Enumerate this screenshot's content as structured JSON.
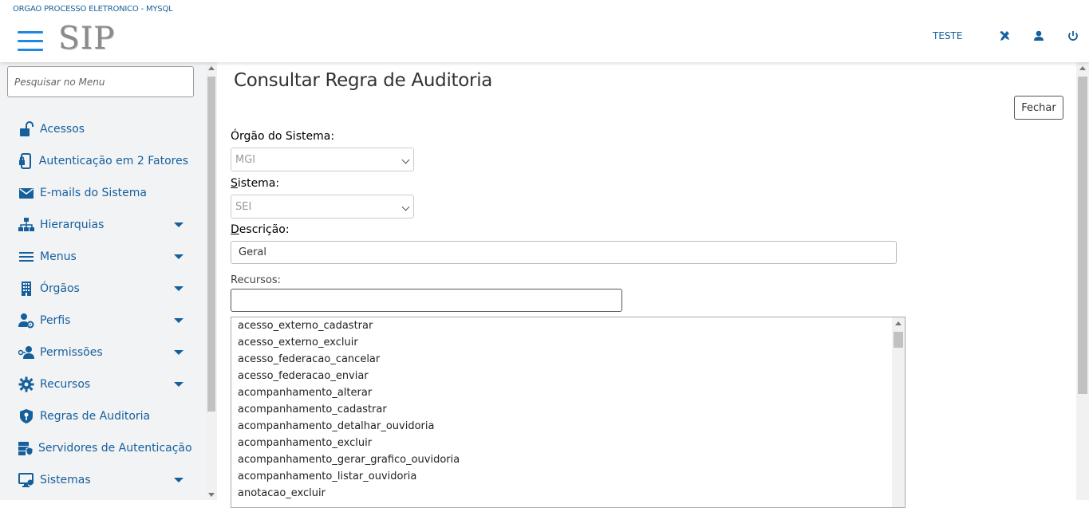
{
  "header": {
    "org_title": "ORGAO PROCESSO ELETRONICO - MYSQL",
    "logo": "SIP",
    "user": "TESTE",
    "icons": [
      "tools-icon",
      "user-icon",
      "power-icon"
    ]
  },
  "sidebar": {
    "search_placeholder": "Pesquisar no Menu",
    "items": [
      {
        "label": "Acessos",
        "icon": "lock-open-icon",
        "expandable": false
      },
      {
        "label": "Autenticação em 2 Fatores",
        "icon": "phone-lock-icon",
        "expandable": false
      },
      {
        "label": "E-mails do Sistema",
        "icon": "envelope-icon",
        "expandable": false
      },
      {
        "label": "Hierarquias",
        "icon": "sitemap-icon",
        "expandable": true
      },
      {
        "label": "Menus",
        "icon": "bars-icon",
        "expandable": true
      },
      {
        "label": "Órgãos",
        "icon": "building-icon",
        "expandable": true
      },
      {
        "label": "Perfis",
        "icon": "user-cog-icon",
        "expandable": true
      },
      {
        "label": "Permissões",
        "icon": "user-key-icon",
        "expandable": true
      },
      {
        "label": "Recursos",
        "icon": "gear-icon",
        "expandable": true
      },
      {
        "label": "Regras de Auditoria",
        "icon": "shield-key-icon",
        "expandable": false
      },
      {
        "label": "Servidores de Autenticação",
        "icon": "server-shield-icon",
        "expandable": false
      },
      {
        "label": "Sistemas",
        "icon": "monitor-cog-icon",
        "expandable": true
      }
    ]
  },
  "main": {
    "title": "Consultar Regra de Auditoria",
    "close_button": "Fechar",
    "orgao_label": "Órgão do Sistema",
    "orgao_value": "MGI",
    "sistema_label_underlined": "S",
    "sistema_label_rest": "istema",
    "sistema_value": "SEI",
    "descricao_label_underlined": "D",
    "descricao_label_rest": "escrição",
    "descricao_value": "Geral",
    "recursos_label": "Recursos:",
    "recursos_filter_value": "",
    "recursos": [
      "acesso_externo_cadastrar",
      "acesso_externo_excluir",
      "acesso_federacao_cancelar",
      "acesso_federacao_enviar",
      "acompanhamento_alterar",
      "acompanhamento_cadastrar",
      "acompanhamento_detalhar_ouvidoria",
      "acompanhamento_excluir",
      "acompanhamento_gerar_grafico_ouvidoria",
      "acompanhamento_listar_ouvidoria",
      "anotacao_excluir"
    ]
  },
  "colors": {
    "accent": "#155f9c",
    "hamburger": "#1e88e5",
    "sidebar_bg": "#f2f3f5"
  }
}
